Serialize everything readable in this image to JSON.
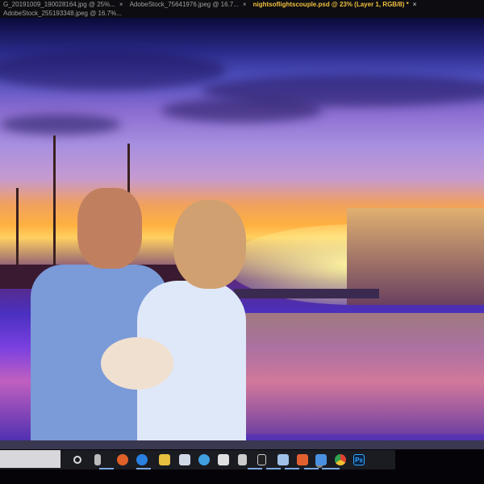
{
  "tabs": [
    {
      "label": "G_20191009_190028164.jpg @ 25%...",
      "close": "×",
      "active": false
    },
    {
      "label": "AdobeStock_75641976.jpeg @ 16.7...",
      "close": "×",
      "active": false
    },
    {
      "label": "nightsoflightscouple.psd @ 23% (Layer 1, RGB/8) *",
      "close": "×",
      "active": true
    },
    {
      "label": "AdobeStock_255193348.jpeg @ 16.7%...",
      "close": "",
      "active": false
    }
  ],
  "taskbar": {
    "icons": [
      "cortana-icon",
      "task-view-icon",
      "firefox-icon",
      "edge-icon",
      "file-explorer-icon",
      "store-icon",
      "internet-explorer-icon",
      "mail-icon",
      "calculator-icon",
      "app-icon",
      "notepad-icon",
      "brave-icon",
      "app2-icon",
      "chrome-icon",
      "photoshop-icon"
    ],
    "badge": "60",
    "photoshop_label": "Ps"
  },
  "colors": {
    "accent": "#f0c040",
    "taskbar": "#1a1c22"
  }
}
